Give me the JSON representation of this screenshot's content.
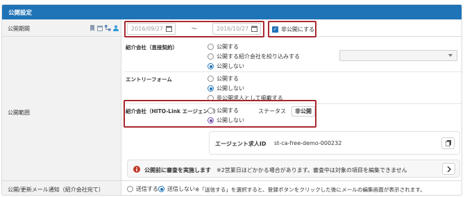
{
  "section": {
    "title": "公開設定"
  },
  "period": {
    "label": "公開期間",
    "start_placeholder": "2016/09/27",
    "range_sep": "〜",
    "end_placeholder": "2016/10/27",
    "private_checkbox_label": "非公開にする"
  },
  "scope": {
    "label": "公開範囲",
    "direct_company": {
      "title": "紹介会社（直接契約）",
      "options": [
        "公開する",
        "公開する紹介会社を絞り込みする",
        "公開しない"
      ],
      "selected": 2
    },
    "entry_form": {
      "title": "エントリーフォーム",
      "options": [
        "公開する",
        "公開しない",
        "非公開求人として掲載する"
      ],
      "selected": 1
    },
    "hito_link": {
      "title": "紹介会社（HITO-Link エージェント）",
      "options": [
        "公開する",
        "公開しない"
      ],
      "selected": 1,
      "status_label": "ステータス",
      "status_value": "非公開"
    },
    "agent_job_id_label": "エージェント求人ID",
    "agent_job_id_value": "st-ca-free-demo-000232",
    "review_notice": {
      "title": "公開前に審査を実施します",
      "text": "※2営業日ほどかかる場合があります。審査中は対象の項目を編集できません"
    }
  },
  "mail": {
    "label": "公開/更新メール通知（紹介会社宛て）",
    "options": [
      "送信する",
      "送信しない"
    ],
    "selected": 1,
    "note": "※「送信する」を選択すると、登録ボタンをクリックした後にメールの編集画面が表示されます。"
  },
  "colors": {
    "header_blue": "#1f73b7",
    "highlight_red": "#a8262d",
    "radio_purple": "#6d4aa8"
  },
  "icons": [
    "bookmark-icon",
    "calendar-icon",
    "network-icon",
    "person-icon",
    "info-icon",
    "copy-icon",
    "chevron-right-icon",
    "chevron-down-icon"
  ]
}
